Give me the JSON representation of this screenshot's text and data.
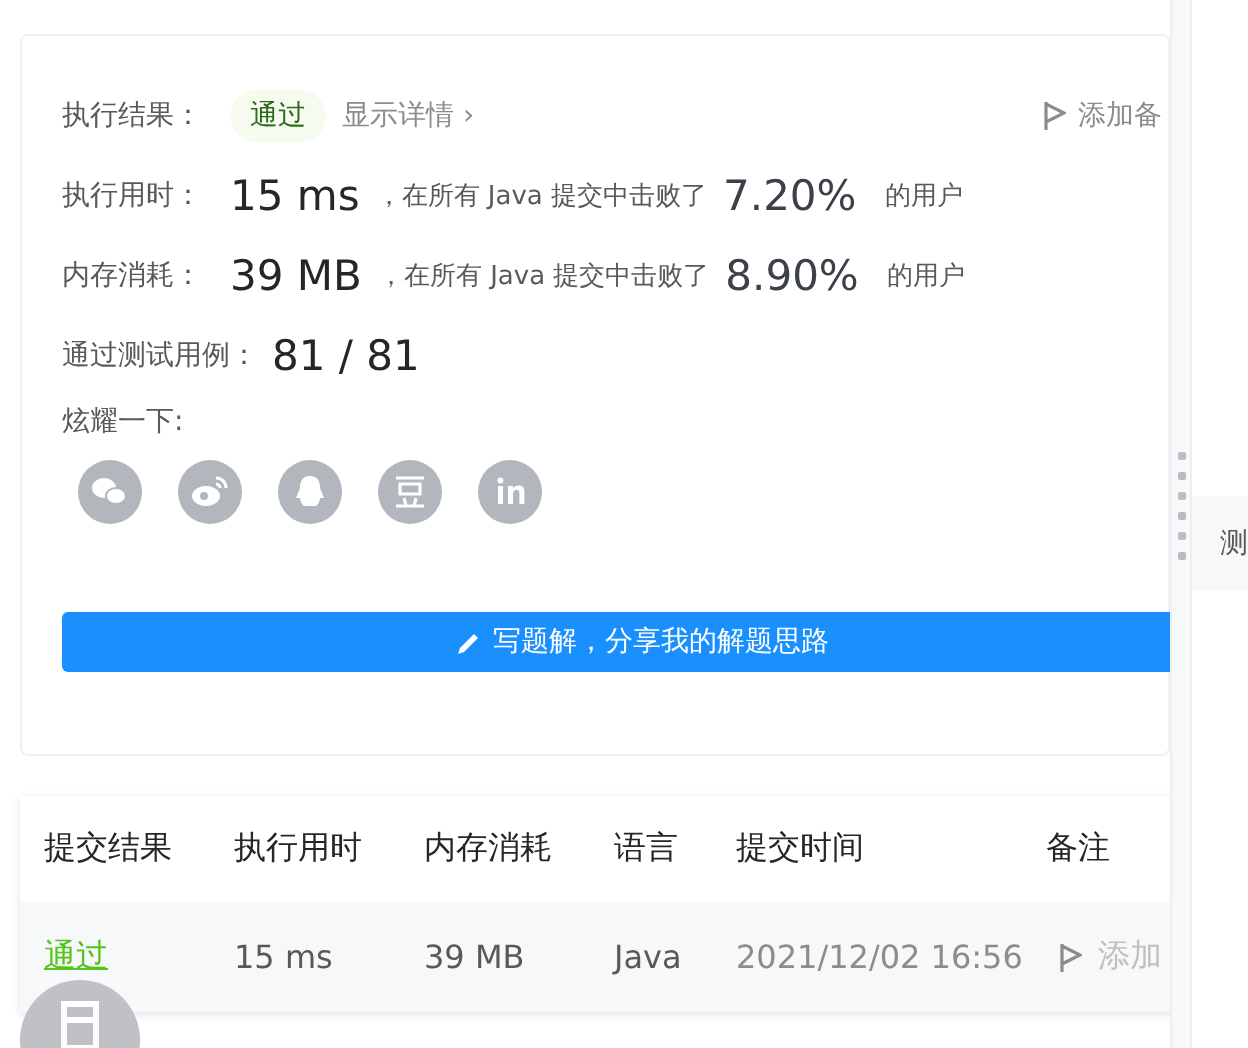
{
  "result": {
    "label": "执行结果：",
    "status": "通过",
    "details_link": "显示详情 ›",
    "note_button": "添加备"
  },
  "stats": [
    {
      "label": "执行用时：",
      "value": "15 ms",
      "middle": "，在所有 Java 提交中击败了",
      "percent": "7.20%",
      "suffix": "的用户"
    },
    {
      "label": "内存消耗：",
      "value": "39 MB",
      "middle": "，在所有 Java 提交中击败了",
      "percent": "8.90%",
      "suffix": "的用户"
    }
  ],
  "tests": {
    "label": "通过测试用例：",
    "value": "81 / 81"
  },
  "share": {
    "label": "炫耀一下:",
    "icons": [
      {
        "kind": "wechat"
      },
      {
        "kind": "weibo"
      },
      {
        "kind": "qq"
      },
      {
        "kind": "douban"
      },
      {
        "kind": "linkedin"
      }
    ]
  },
  "write_button": "写题解，分享我的解题思路",
  "table": {
    "columns": [
      "提交结果",
      "执行用时",
      "内存消耗",
      "语言",
      "提交时间",
      "备注"
    ],
    "rows": [
      {
        "result": "通过",
        "time": "15 ms",
        "memory": "39 MB",
        "language": "Java",
        "submitted": "2021/12/02 16:56",
        "note": "添加"
      }
    ]
  },
  "side_panel": {
    "tab": "测"
  }
}
